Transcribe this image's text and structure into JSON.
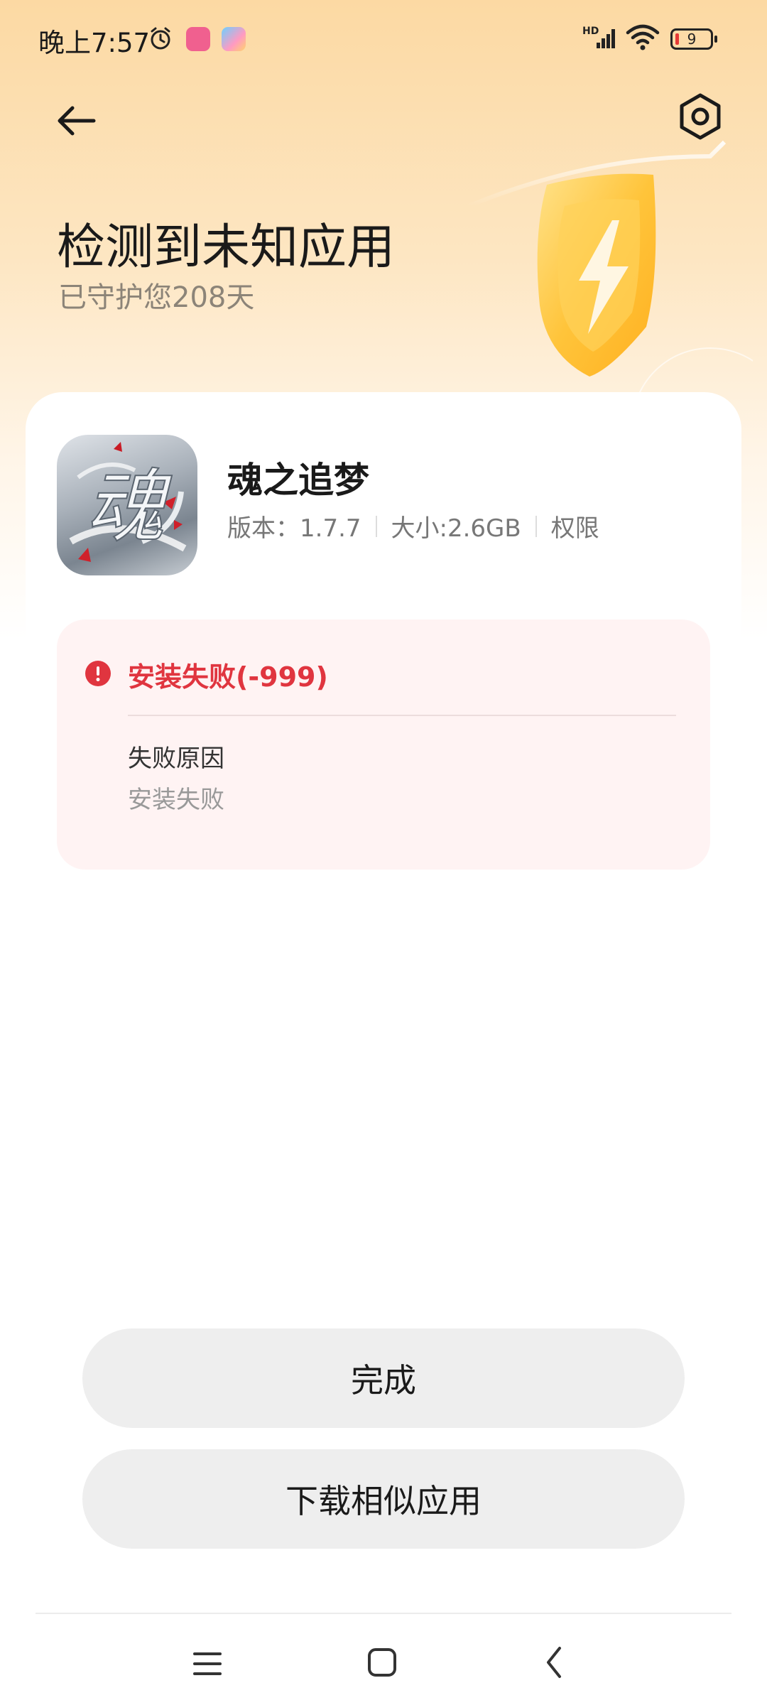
{
  "status_bar": {
    "time": "晚上7:57",
    "network_label": "HD",
    "battery_level": "9",
    "icons": [
      "alarm-icon",
      "bilibili-app-icon",
      "game-app-icon",
      "signal-icon",
      "wifi-icon",
      "battery-icon"
    ]
  },
  "header": {
    "back_icon": "arrow-left-icon",
    "settings_icon": "gear-icon",
    "title": "检测到未知应用",
    "subtitle": "已守护您208天"
  },
  "app": {
    "name": "魂之追梦",
    "icon_text": "魂",
    "version": "版本：1.7.7",
    "size": "大小:2.6GB",
    "permissions": "权限"
  },
  "error": {
    "title": "安装失败(-999)",
    "reason_label": "失败原因",
    "reason_value": "安装失败"
  },
  "buttons": {
    "done": "完成",
    "download_similar": "下载相似应用"
  },
  "colors": {
    "error_red": "#e0353f",
    "error_bg": "#fff3f3",
    "header_gradient_top": "#fcd9a3",
    "shield_yellow": "#ffc83a"
  }
}
